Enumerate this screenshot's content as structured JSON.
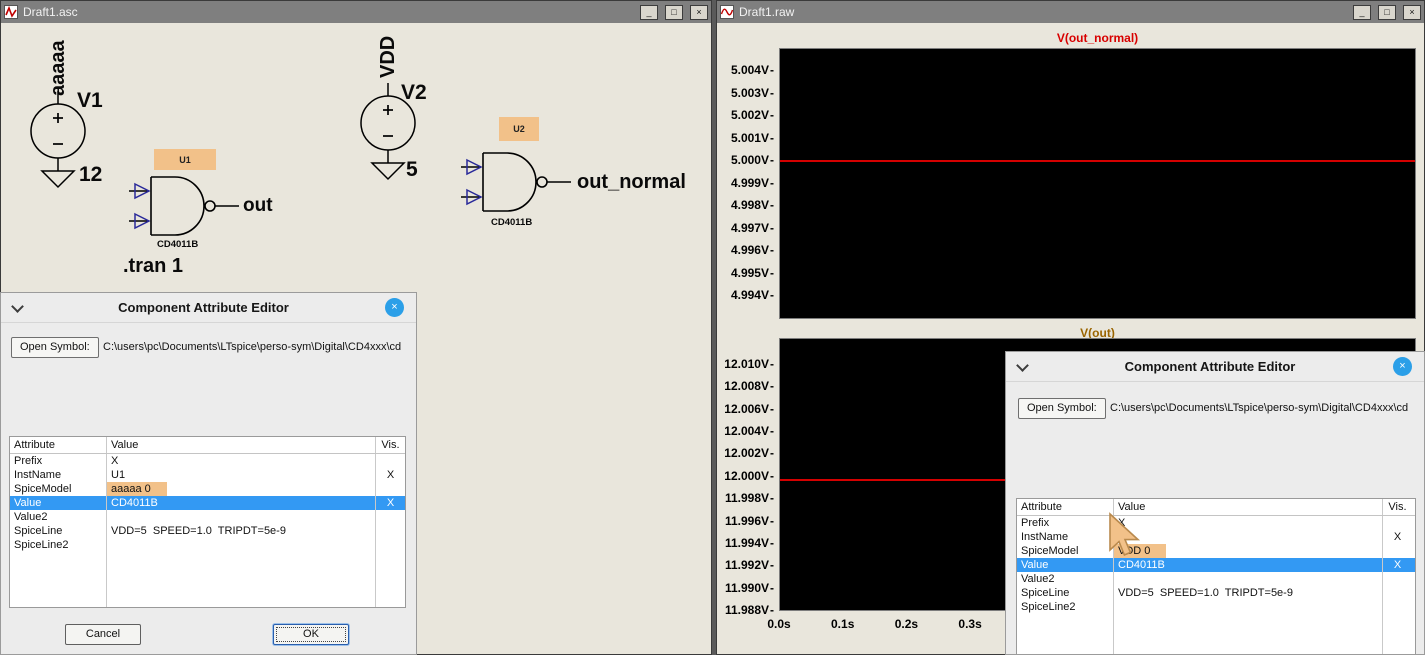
{
  "chrome": {
    "minimize_icon": "_",
    "maximize_icon": "□",
    "close_icon": "×"
  },
  "schematic_window": {
    "title": "Draft1.asc",
    "directive": ".tran 1",
    "v1": {
      "net_label": "aaaaa",
      "name": "V1",
      "value": "12"
    },
    "v2": {
      "net_label": "VDD",
      "name": "V2",
      "value": "5"
    },
    "u1": {
      "designator": "U1",
      "model": "CD4011B",
      "output_net": "out"
    },
    "u2": {
      "designator": "U2",
      "model": "CD4011B",
      "output_net": "out_normal"
    }
  },
  "waveform_window": {
    "title": "Draft1.raw",
    "x_ticks": [
      "0.0s",
      "0.1s",
      "0.2s",
      "0.3s"
    ],
    "chart_data": [
      {
        "type": "line",
        "title": "V(out_normal)",
        "title_color": "#d80000",
        "trace_color": "#d40000",
        "y_ticks": [
          "5.004V",
          "5.003V",
          "5.002V",
          "5.001V",
          "5.000V",
          "4.999V",
          "4.998V",
          "4.997V",
          "4.996V",
          "4.995V",
          "4.994V"
        ],
        "ylim": [
          4.994,
          5.004
        ],
        "series": [
          {
            "name": "V(out_normal)",
            "constant_value_v": 5.0,
            "x_range_s": [
              0.0,
              1.0
            ]
          }
        ],
        "grid": false,
        "background": "#000000"
      },
      {
        "type": "line",
        "title": "V(out)",
        "title_color": "#9a6400",
        "trace_color": "#d40000",
        "y_ticks": [
          "12.010V",
          "12.008V",
          "12.006V",
          "12.004V",
          "12.002V",
          "12.000V",
          "11.998V",
          "11.996V",
          "11.994V",
          "11.992V",
          "11.990V",
          "11.988V"
        ],
        "ylim": [
          11.988,
          12.01
        ],
        "series": [
          {
            "name": "V(out)",
            "constant_value_v": 12.0,
            "x_range_s": [
              0.0,
              1.0
            ]
          }
        ],
        "grid": false,
        "background": "#000000"
      }
    ]
  },
  "dialog_u1": {
    "title": "Component Attribute Editor",
    "open_symbol_button": "Open Symbol:",
    "symbol_path": "C:\\users\\pc\\Documents\\LTspice\\perso-sym\\Digital\\CD4xxx\\cd",
    "columns": {
      "attribute": "Attribute",
      "value": "Value",
      "vis": "Vis."
    },
    "rows": [
      {
        "attribute": "Prefix",
        "value": "X",
        "vis": ""
      },
      {
        "attribute": "InstName",
        "value": "U1",
        "vis": "X"
      },
      {
        "attribute": "SpiceModel",
        "value": "aaaaa 0",
        "vis": ""
      },
      {
        "attribute": "Value",
        "value": "CD4011B",
        "vis": "X"
      },
      {
        "attribute": "Value2",
        "value": "",
        "vis": ""
      },
      {
        "attribute": "SpiceLine",
        "value": "VDD=5  SPEED=1.0  TRIPDT=5e-9",
        "vis": ""
      },
      {
        "attribute": "SpiceLine2",
        "value": "",
        "vis": ""
      }
    ],
    "cancel_button": "Cancel",
    "ok_button": "OK",
    "highlight_color": "#f2c189",
    "selection_color": "#3399f3"
  },
  "dialog_u2": {
    "title": "Component Attribute Editor",
    "open_symbol_button": "Open Symbol:",
    "symbol_path": "C:\\users\\pc\\Documents\\LTspice\\perso-sym\\Digital\\CD4xxx\\cd",
    "columns": {
      "attribute": "Attribute",
      "value": "Value",
      "vis": "Vis."
    },
    "rows": [
      {
        "attribute": "Prefix",
        "value": "X",
        "vis": ""
      },
      {
        "attribute": "InstName",
        "value": "U2",
        "vis": "X"
      },
      {
        "attribute": "SpiceModel",
        "value": "VDD 0",
        "vis": ""
      },
      {
        "attribute": "Value",
        "value": "CD4011B",
        "vis": "X"
      },
      {
        "attribute": "Value2",
        "value": "",
        "vis": ""
      },
      {
        "attribute": "SpiceLine",
        "value": "VDD=5  SPEED=1.0  TRIPDT=5e-9",
        "vis": ""
      },
      {
        "attribute": "SpiceLine2",
        "value": "",
        "vis": ""
      }
    ],
    "highlight_color": "#f2c189",
    "selection_color": "#3399f3"
  }
}
